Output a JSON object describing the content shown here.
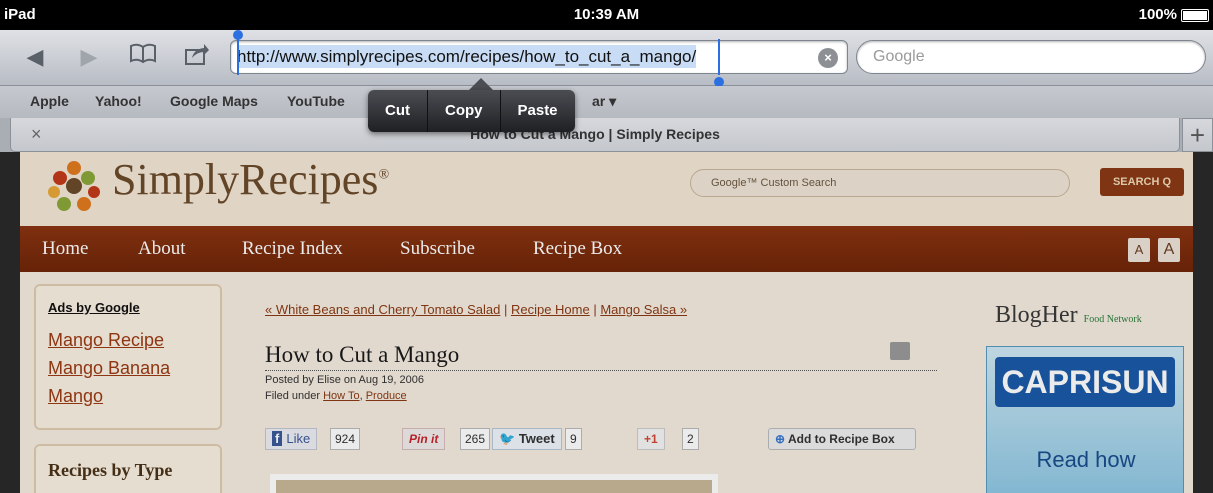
{
  "status": {
    "device": "iPad",
    "time": "10:39 AM",
    "battery": "100%"
  },
  "toolbar": {
    "url": "http://www.simplyrecipes.com/recipes/how_to_cut_a_mango/",
    "search_placeholder": "Google"
  },
  "bookmarks": [
    "Apple",
    "Yahoo!",
    "Google Maps",
    "YouTube",
    "ar ▾"
  ],
  "edit_menu": {
    "cut": "Cut",
    "copy": "Copy",
    "paste": "Paste"
  },
  "tab": {
    "title": "How to Cut a Mango | Simply Recipes",
    "close": "×",
    "new": "+"
  },
  "site": {
    "logo": "SimplyRecipes",
    "logo_mark": "®",
    "search_placeholder": "Google™ Custom Search",
    "search_button": "SEARCH Q",
    "nav": [
      "Home",
      "About",
      "Recipe Index",
      "Subscribe",
      "Recipe Box"
    ],
    "font_small": "A",
    "font_large": "A"
  },
  "ads": {
    "heading": "Ads by Google",
    "links": [
      "Mango Recipe",
      "Mango Banana",
      "Mango"
    ]
  },
  "recipes_by_type": "Recipes by Type",
  "article": {
    "prev": "« White Beans and Cherry Tomato Salad",
    "sep": " | ",
    "home": "Recipe Home",
    "next": "Mango Salsa »",
    "title": "How to Cut a Mango",
    "posted": "Posted by Elise on Aug 19, 2006",
    "filed_prefix": "Filed under ",
    "filed_cat1": "How To",
    "filed_sep": ", ",
    "filed_cat2": "Produce"
  },
  "social": {
    "fb_label": "Like",
    "fb_count": "924",
    "pin_label": "Pin it",
    "pin_count": "265",
    "tweet_label": "Tweet",
    "tweet_count": "9",
    "gplus_label": "+1",
    "gplus_count": "2",
    "add_box": "Add to Recipe Box"
  },
  "sidebar": {
    "blogher": "BlogHer",
    "blogher_sub": "Food Network",
    "ad_brand": "CAPRISUN",
    "ad_text": "Read how"
  }
}
